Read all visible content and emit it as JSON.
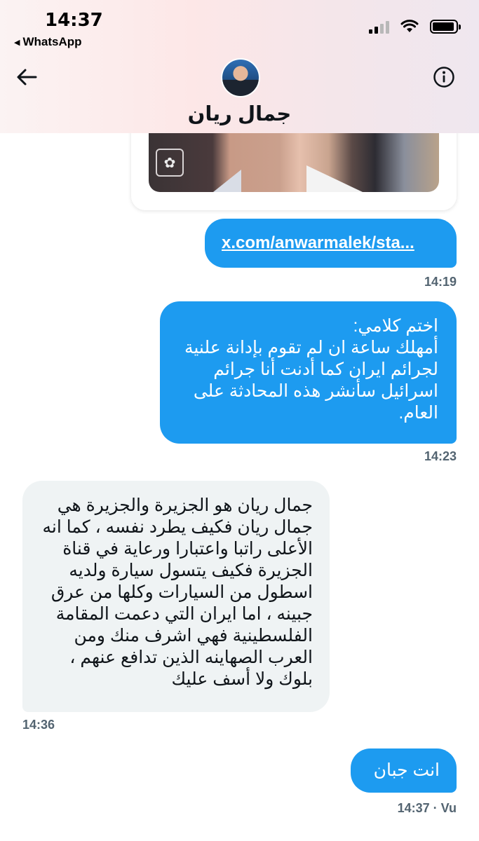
{
  "status_bar": {
    "time": "14:37",
    "back_app_label": "WhatsApp"
  },
  "header": {
    "contact_name": "جمال ريان",
    "back_icon": "arrow-left-icon",
    "info_icon": "info-circle-icon"
  },
  "messages": [
    {
      "direction": "outgoing",
      "text": "x.com/anwarmalek/sta...",
      "time": "14:19",
      "is_link": true
    },
    {
      "direction": "outgoing",
      "text": "اختم كلامي:\nأمهلك ساعة ان لم تقوم بإدانة علنية لجرائم ايران كما أدنت أنا جرائم اسرائيل سأنشر هذه المحادثة على العام.",
      "time": "14:23"
    },
    {
      "direction": "incoming",
      "text": "جمال ريان هو الجزيرة والجزيرة هي جمال ريان فكيف يطرد نفسه ، كما انه الأعلى راتبا واعتبارا ورعاية في قناة الجزيرة فكيف يتسول سيارة ولديه اسطول من السيارات وكلها من عرق جبينه ، اما ايران التي دعمت المقامة الفلسطينية فهي اشرف منك ومن العرب الصهاينه الذين تدافع عنهم ، بلوك ولا أسف عليك",
      "time": "14:36"
    },
    {
      "direction": "outgoing",
      "text": "انت جبان",
      "time": "14:37 · Vu"
    }
  ],
  "colors": {
    "outgoing_bubble": "#1d9bf0",
    "incoming_bubble": "#eff3f4",
    "timestamp": "#536471"
  }
}
